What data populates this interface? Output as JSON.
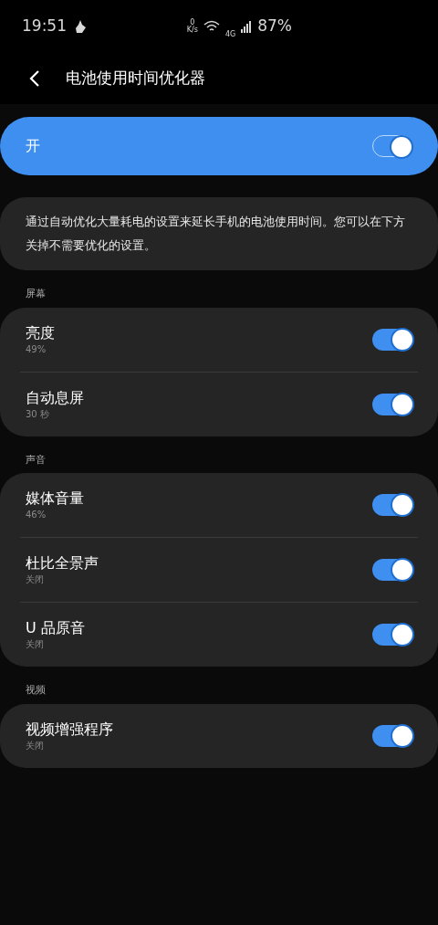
{
  "status_bar": {
    "time": "19:51",
    "net_speed_value": "0",
    "net_speed_unit": "K/s",
    "network": "4G",
    "battery": "87%"
  },
  "header": {
    "title": "电池使用时间优化器"
  },
  "master": {
    "label": "开",
    "on": true
  },
  "description": "通过自动优化大量耗电的设置来延长手机的电池使用时间。您可以在下方关掉不需要优化的设置。",
  "sections": [
    {
      "title": "屏幕",
      "items": [
        {
          "label": "亮度",
          "value": "49%",
          "on": true
        },
        {
          "label": "自动息屏",
          "value": "30 秒",
          "on": true
        }
      ]
    },
    {
      "title": "声音",
      "items": [
        {
          "label": "媒体音量",
          "value": "46%",
          "on": true
        },
        {
          "label": "杜比全景声",
          "value": "关闭",
          "on": true
        },
        {
          "label": "U 品原音",
          "value": "关闭",
          "on": true
        }
      ]
    },
    {
      "title": "视频",
      "items": [
        {
          "label": "视频增强程序",
          "value": "关闭",
          "on": true
        }
      ]
    }
  ]
}
